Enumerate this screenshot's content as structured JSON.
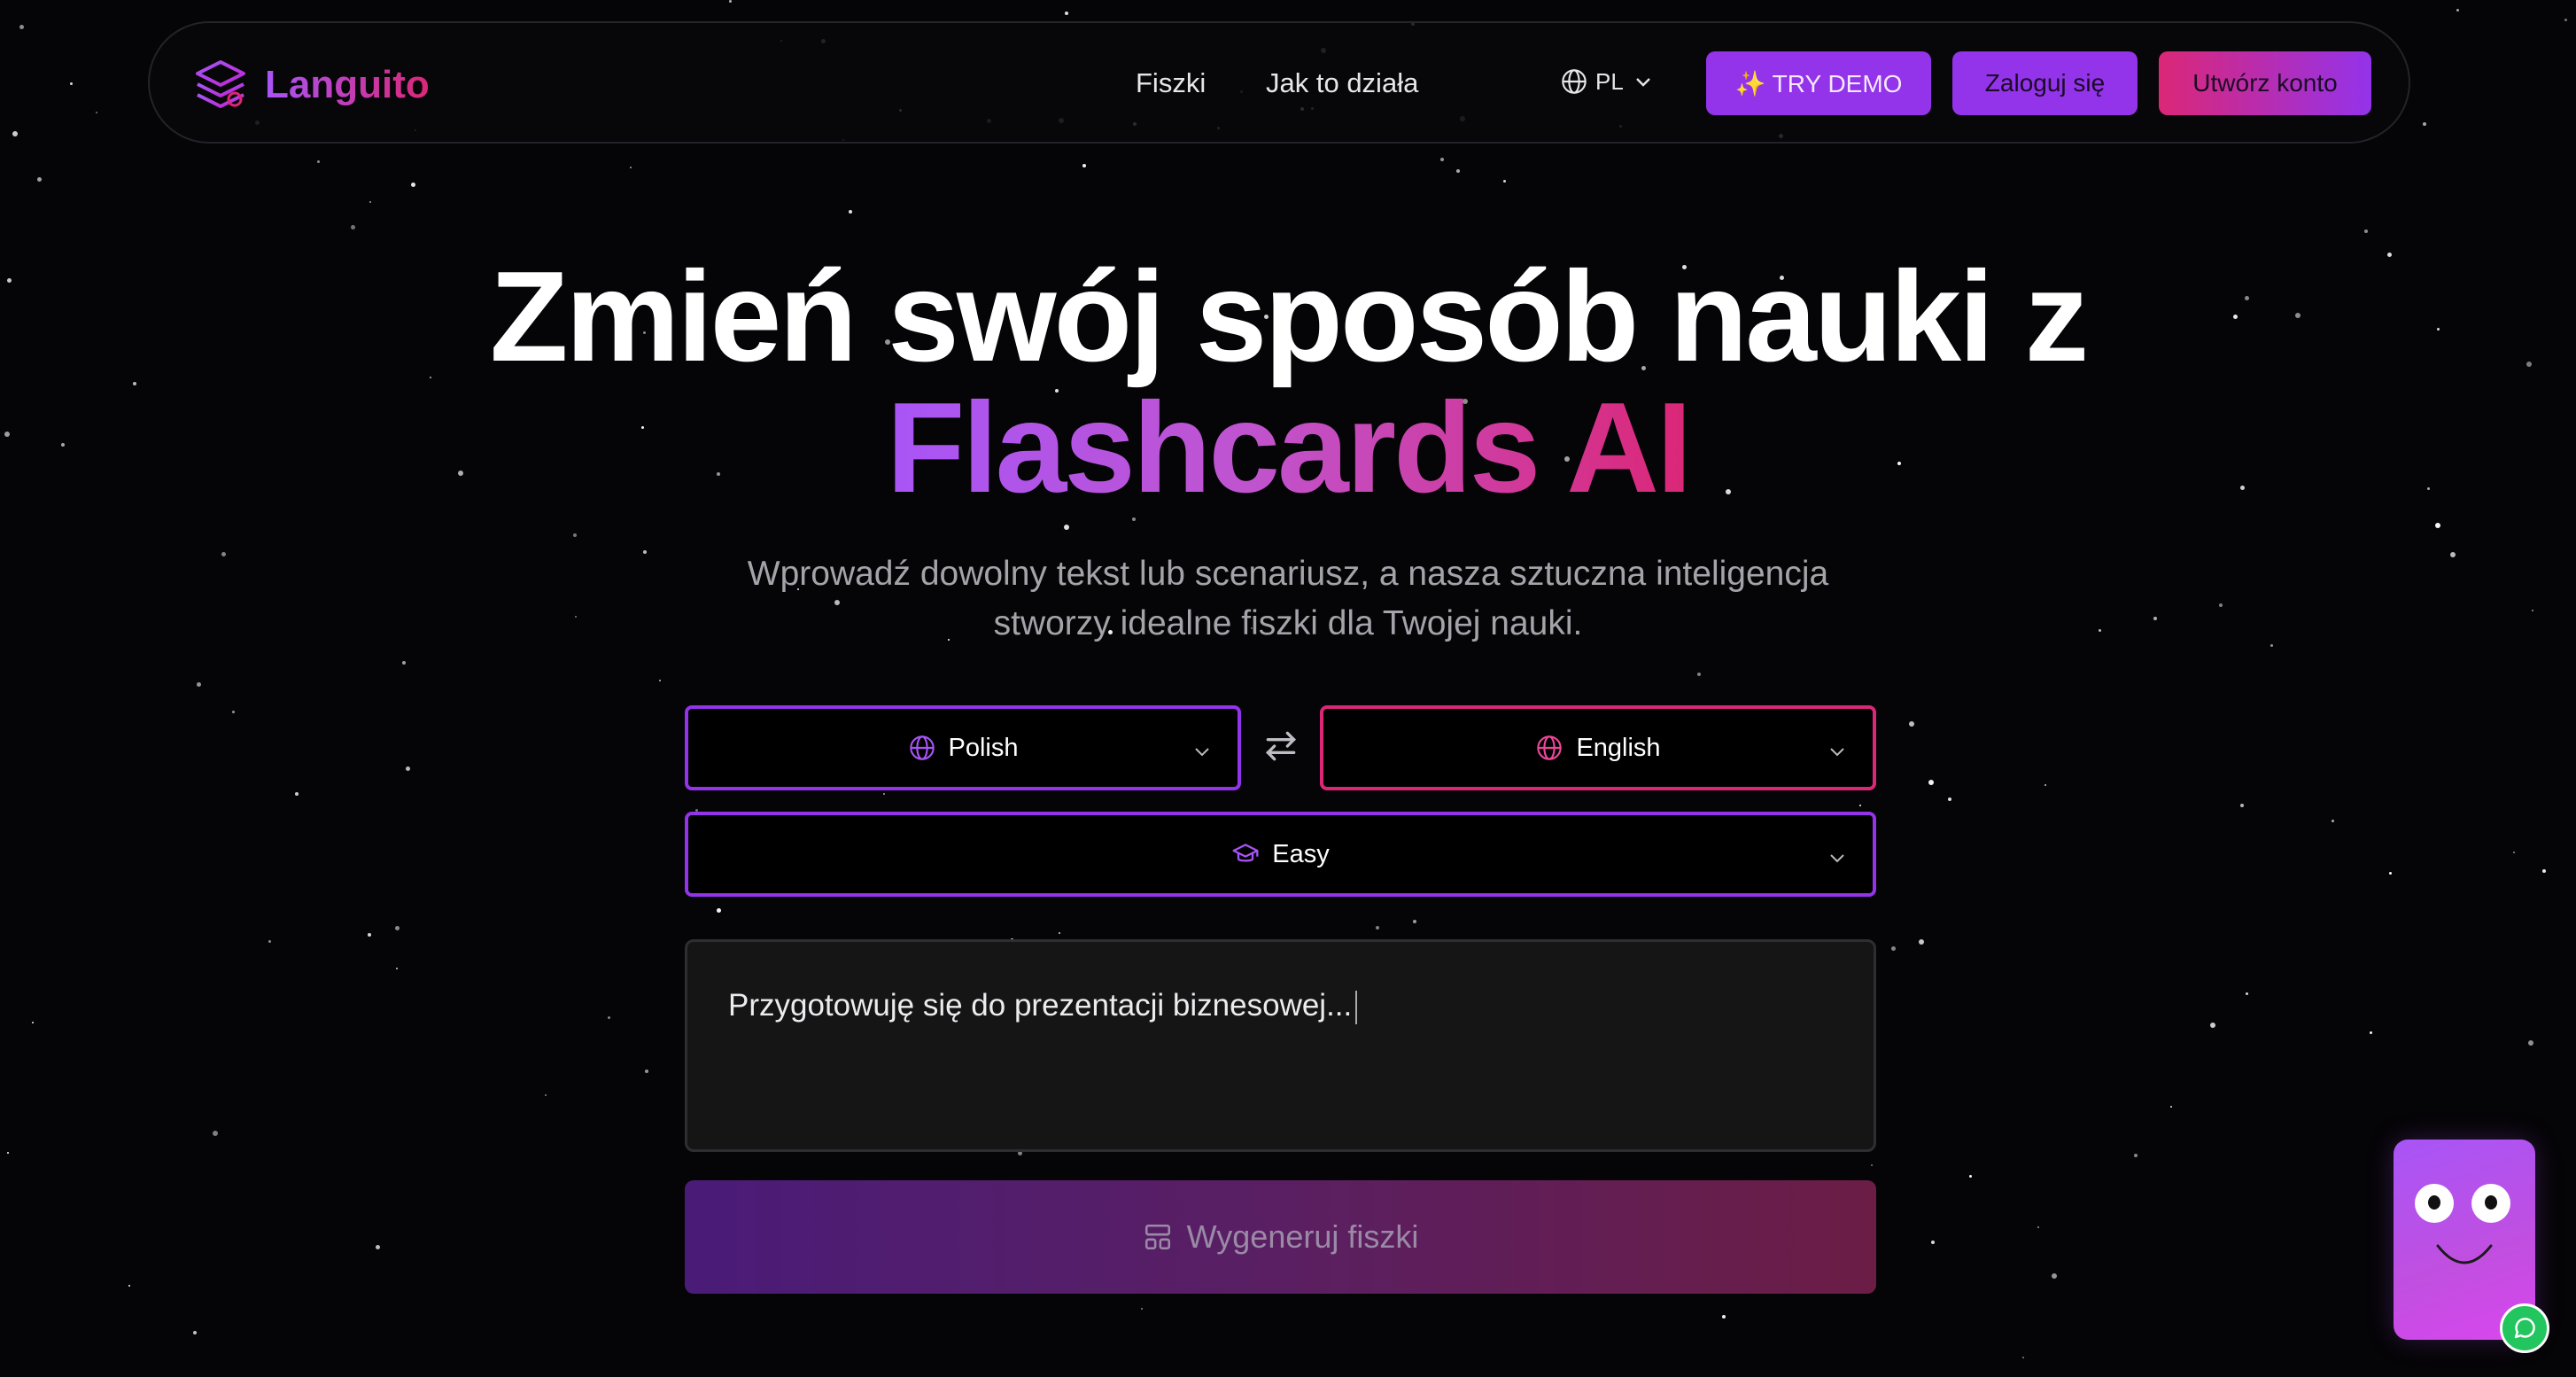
{
  "brand": {
    "name": "Languito",
    "logo_icon": "layers-icon",
    "color_start": "#a855f7",
    "color_end": "#db2777"
  },
  "nav": {
    "links": [
      "Fiszki",
      "Jak to działa"
    ],
    "language": "PL",
    "try_demo": "✨ TRY DEMO",
    "login": "Zaloguj się",
    "signup": "Utwórz konto"
  },
  "hero": {
    "title_line1": "Zmień swój sposób nauki z",
    "title_line2": "Flashcards AI",
    "subtitle_line1": "Wprowadź dowolny tekst lub scenariusz, a nasza sztuczna inteligencja",
    "subtitle_line2": "stworzy idealne fiszki dla Twojej nauki."
  },
  "form": {
    "source_language": "Polish",
    "target_language": "English",
    "level": "Easy",
    "textarea_value": "Przygotowuję się do prezentacji biznesowej...",
    "generate_label": "Wygeneruj fiszki"
  },
  "colors": {
    "purple": "#9333ea",
    "pink": "#db2777",
    "background": "#050406"
  }
}
